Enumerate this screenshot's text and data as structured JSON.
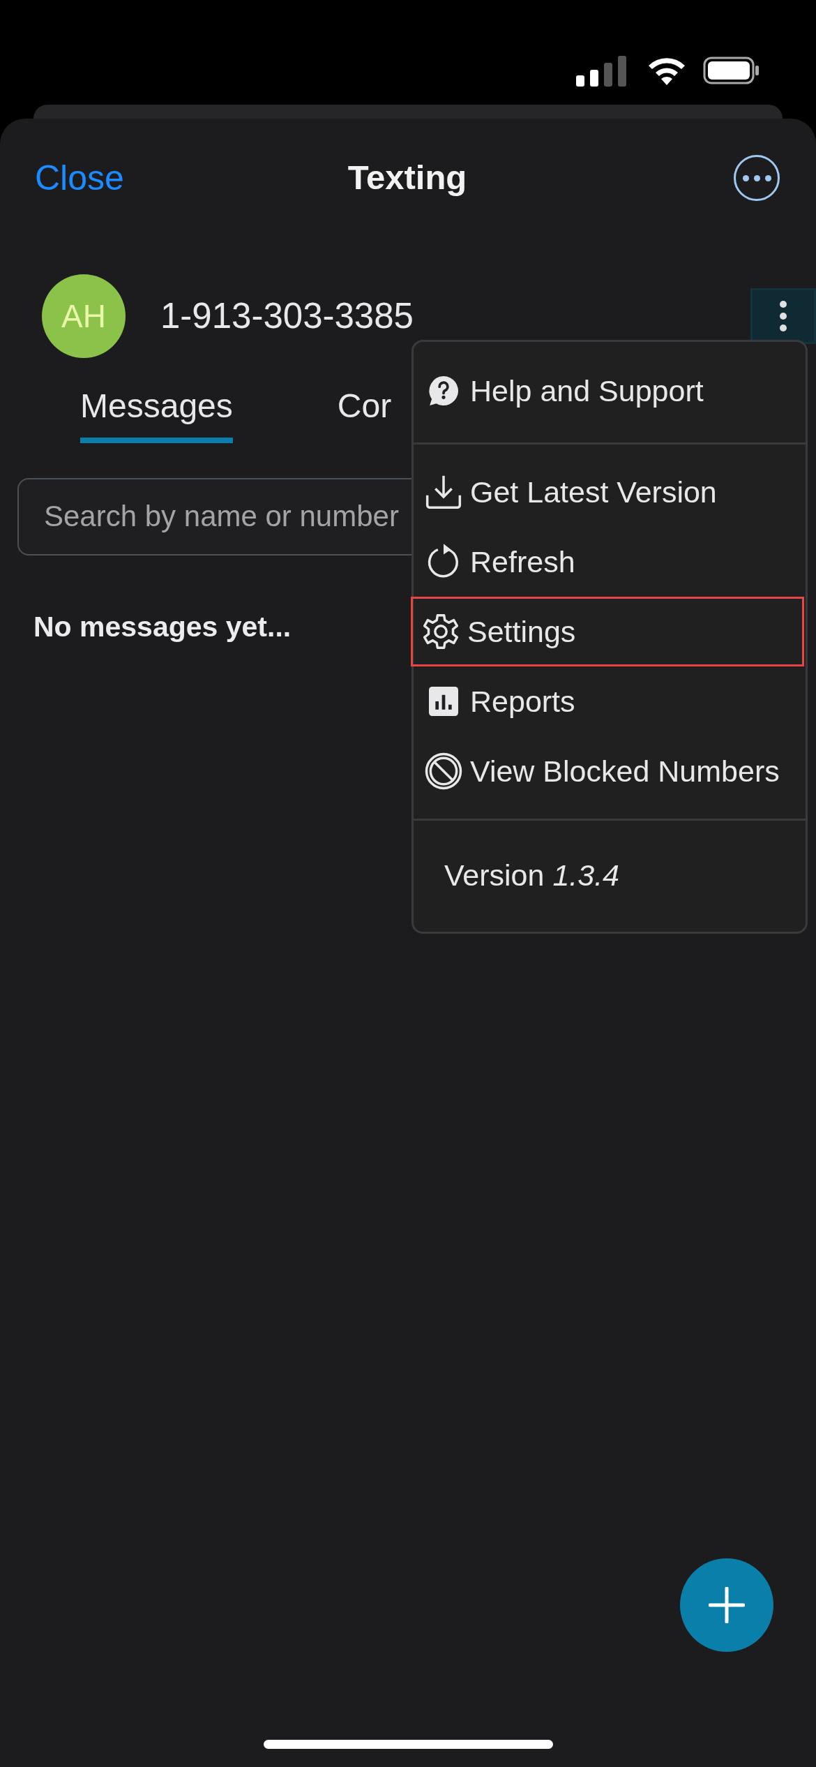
{
  "header": {
    "close": "Close",
    "title": "Texting"
  },
  "contact": {
    "initials": "AH",
    "number": "1-913-303-3385"
  },
  "tabs": [
    {
      "label": "Messages",
      "selected": true
    },
    {
      "label": "Cor",
      "selected": false
    }
  ],
  "search": {
    "placeholder": "Search by name or number"
  },
  "empty_message": "No messages yet...",
  "menu": {
    "groups": [
      [
        {
          "label": "Help and Support",
          "selected": false
        }
      ],
      [
        {
          "label": "Get Latest Version",
          "selected": false
        },
        {
          "label": "Refresh",
          "selected": false
        },
        {
          "label": "Settings",
          "selected": true
        },
        {
          "label": "Reports",
          "selected": false
        },
        {
          "label": "View Blocked Numbers",
          "selected": false
        }
      ]
    ],
    "version": "Version *1.3.4*"
  }
}
